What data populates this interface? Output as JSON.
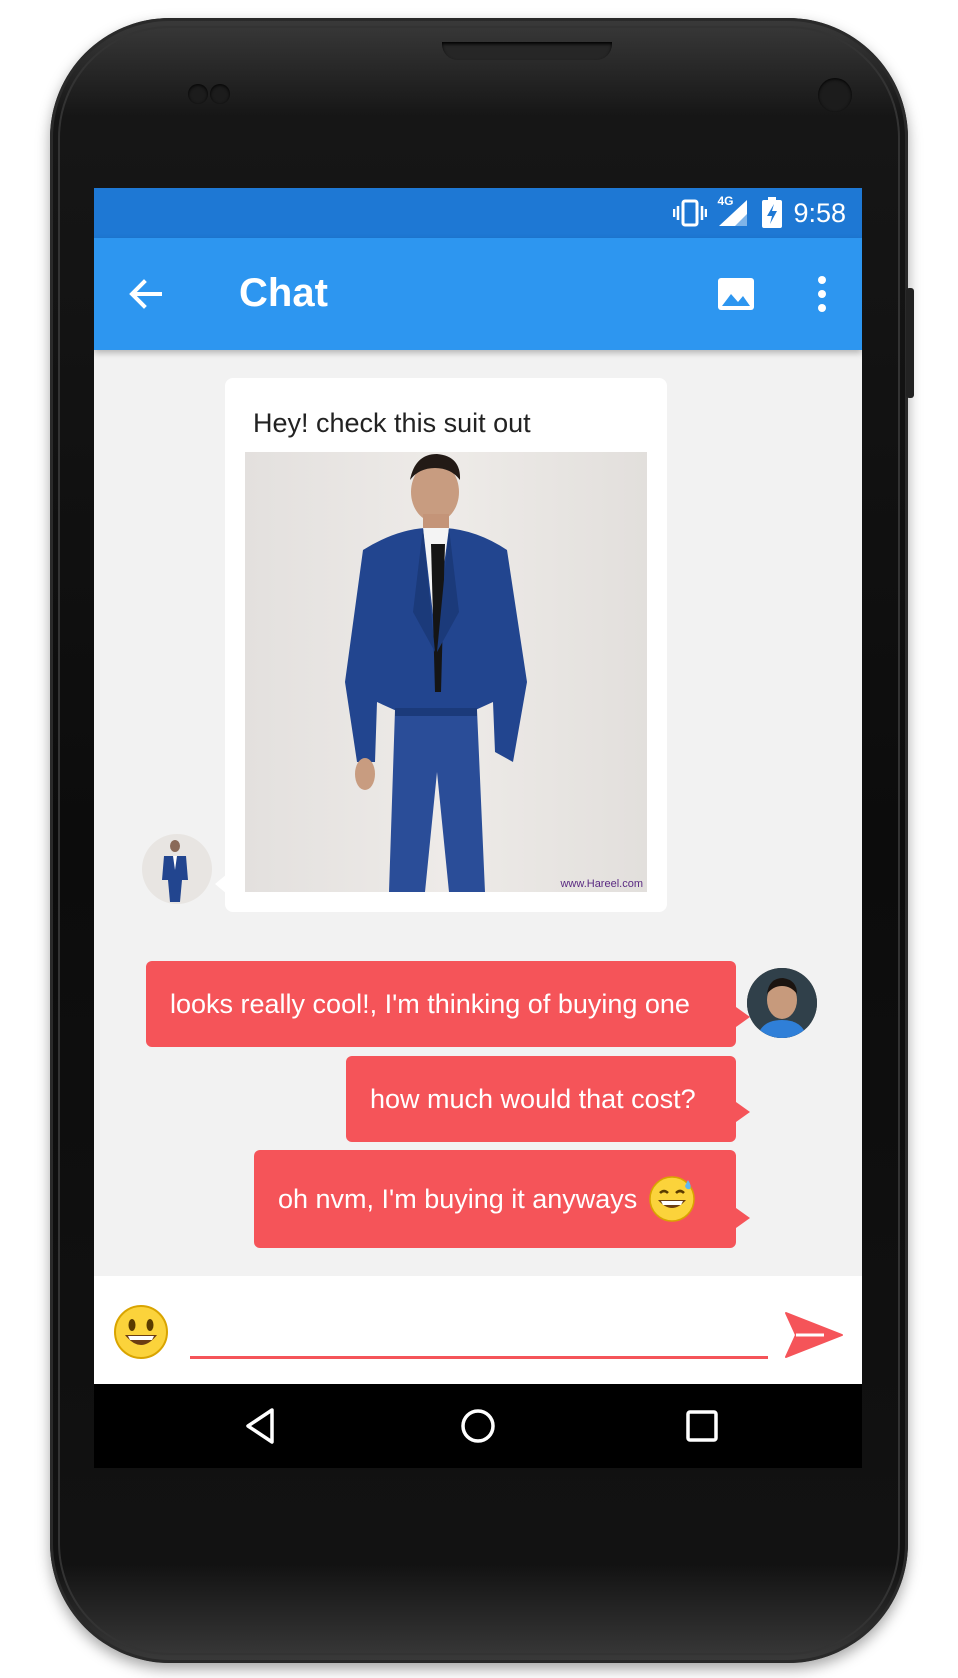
{
  "status_bar": {
    "network": "4G",
    "time": "9:58"
  },
  "app_bar": {
    "title": "Chat",
    "back_icon": "arrow-back-icon",
    "image_icon": "image-icon",
    "more_icon": "more-vert-icon"
  },
  "messages": {
    "incoming": {
      "text": "Hey! check this suit out",
      "image": "man-in-blue-suit-photo",
      "watermark": "www.Hareel.com"
    },
    "outgoing": [
      {
        "text": "looks really cool!, I'm thinking of buying one"
      },
      {
        "text": "how much would that cost?"
      },
      {
        "text": "oh nvm, I'm buying it anyways",
        "emoji": "grinning-sweat-emoji"
      }
    ]
  },
  "composer": {
    "value": "",
    "placeholder": "",
    "emoji_icon": "smiley-icon",
    "send_icon": "send-icon"
  },
  "colors": {
    "status_bar": "#1e78d4",
    "app_bar": "#2d96f0",
    "outgoing_bubble": "#f55459",
    "chat_background": "#f2f2f2",
    "nav_bar": "#000000"
  }
}
